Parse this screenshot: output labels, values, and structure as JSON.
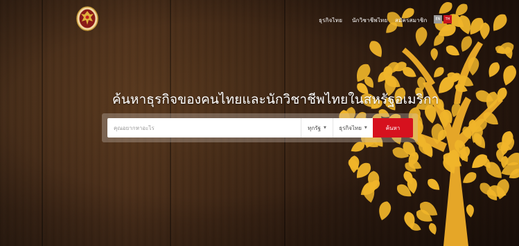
{
  "nav": {
    "items": [
      {
        "label": "ธุรกิจไทย"
      },
      {
        "label": "นักวิชาชีพไทย"
      },
      {
        "label": "สมัครสมาชิก"
      }
    ],
    "lang": {
      "en": "EN",
      "th": "TH"
    }
  },
  "hero": {
    "headline": "ค้นหาธุรกิจของคนไทยและนักวิชาชีพไทยในสหรัฐอเมริกา"
  },
  "search": {
    "placeholder": "คุณอยากหาอะไร",
    "state_select": "ทุกรัฐ",
    "category_select": "ธุรกิจไทย",
    "button_label": "ค้นหา"
  },
  "colors": {
    "accent": "#d6111e",
    "leaf": "#f0b52a",
    "trunk": "#e5a628",
    "wood": "#3a2415"
  }
}
